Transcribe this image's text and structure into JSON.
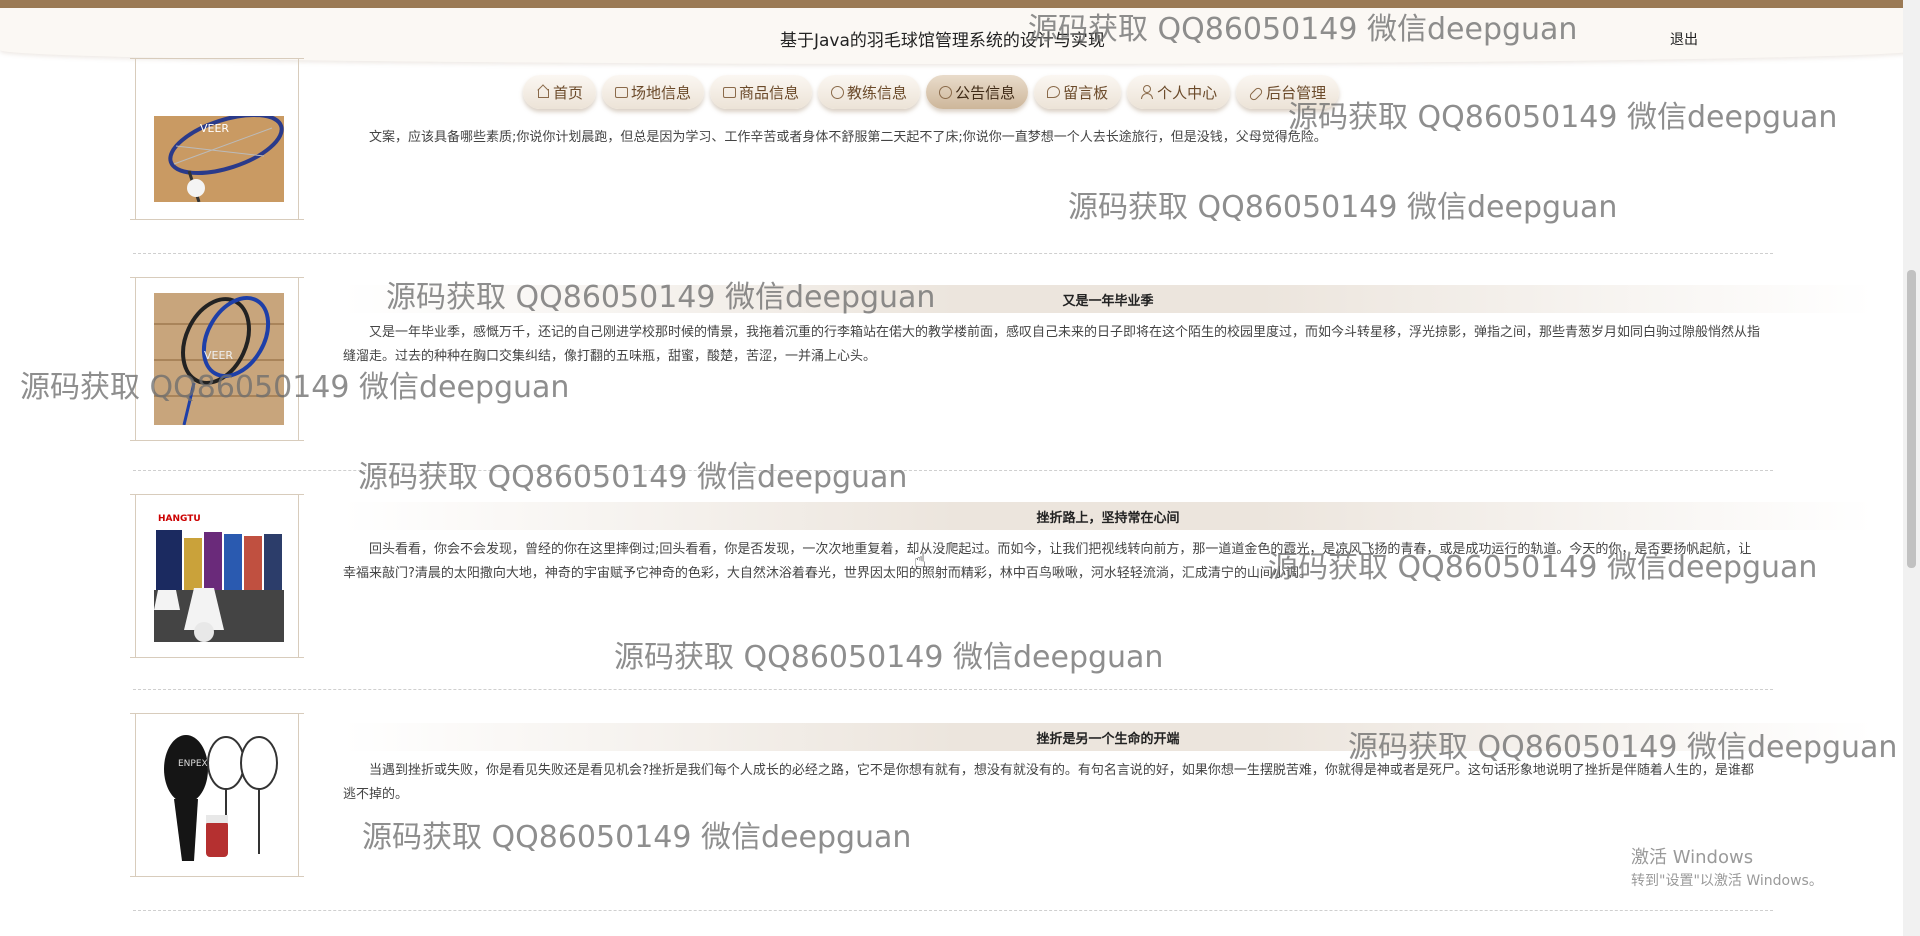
{
  "header": {
    "site_title": "基于Java的羽毛球馆管理系统的设计与实现",
    "logout_label": "退出"
  },
  "nav": {
    "items": [
      {
        "label": "首页",
        "icon": "home-icon"
      },
      {
        "label": "场地信息",
        "icon": "venue-icon"
      },
      {
        "label": "商品信息",
        "icon": "goods-icon"
      },
      {
        "label": "教练信息",
        "icon": "coach-icon"
      },
      {
        "label": "公告信息",
        "icon": "notice-icon",
        "active": true
      },
      {
        "label": "留言板",
        "icon": "message-icon"
      },
      {
        "label": "个人中心",
        "icon": "user-icon"
      },
      {
        "label": "后台管理",
        "icon": "link-icon"
      }
    ]
  },
  "notices": [
    {
      "title": "",
      "body": "文案，应该具备哪些素质;你说你计划晨跑，但总是因为学习、工作辛苦或者身体不舒服第二天起不了床;你说你一直梦想一个人去长途旅行，但是没钱，父母觉得危险。"
    },
    {
      "title": "又是一年毕业季",
      "body": "又是一年毕业季，感慨万千，还记的自己刚进学校那时候的情景，我拖着沉重的行李箱站在偌大的教学楼前面，感叹自己未来的日子即将在这个陌生的校园里度过，而如今斗转星移，浮光掠影，弹指之间，那些青葱岁月如同白驹过隙般悄然从指缝溜走。过去的种种在胸口交集纠结，像打翻的五味瓶，甜蜜，酸楚，苦涩，一并涌上心头。"
    },
    {
      "title": "挫折路上，坚持常在心间",
      "body": "回头看看，你会不会发现，曾经的你在这里摔倒过;回头看看，你是否发现，一次次地重复着，却从没爬起过。而如今，让我们把视线转向前方，那一道道金色的霞光，是凉风飞扬的青春，或是成功运行的轨道。今天的你，是否要扬帆起航，让幸福来敲门?清晨的太阳撒向大地，神奇的宇宙赋予它神奇的色彩，大自然沐浴着春光，世界因太阳的照射而精彩，林中百鸟啾啾，河水轻轻流淌，汇成清宁的山间小调。"
    },
    {
      "title": "挫折是另一个生命的开端",
      "body": "当遇到挫折或失败，你是看见失败还是看见机会?挫折是我们每个人成长的必经之路，它不是你想有就有，想没有就没有的。有句名言说的好，如果你想一生摆脱苦难，你就得是神或者是死尸。这句话形象地说明了挫折是伴随着人生的，是谁都逃不掉的。"
    }
  ],
  "thumb_labels": [
    "VEER",
    "VEER",
    "HANGTU",
    "ENPEX"
  ],
  "watermark_text": "源码获取 QQ86050149 微信deepguan",
  "os_overlay": {
    "activation_title": "激活 Windows",
    "activation_sub": "转到\"设置\"以激活 Windows。"
  },
  "colors": {
    "accent": "#9b7a55",
    "nav_text": "#6b4a2a",
    "title_band": "#ece5dd"
  }
}
